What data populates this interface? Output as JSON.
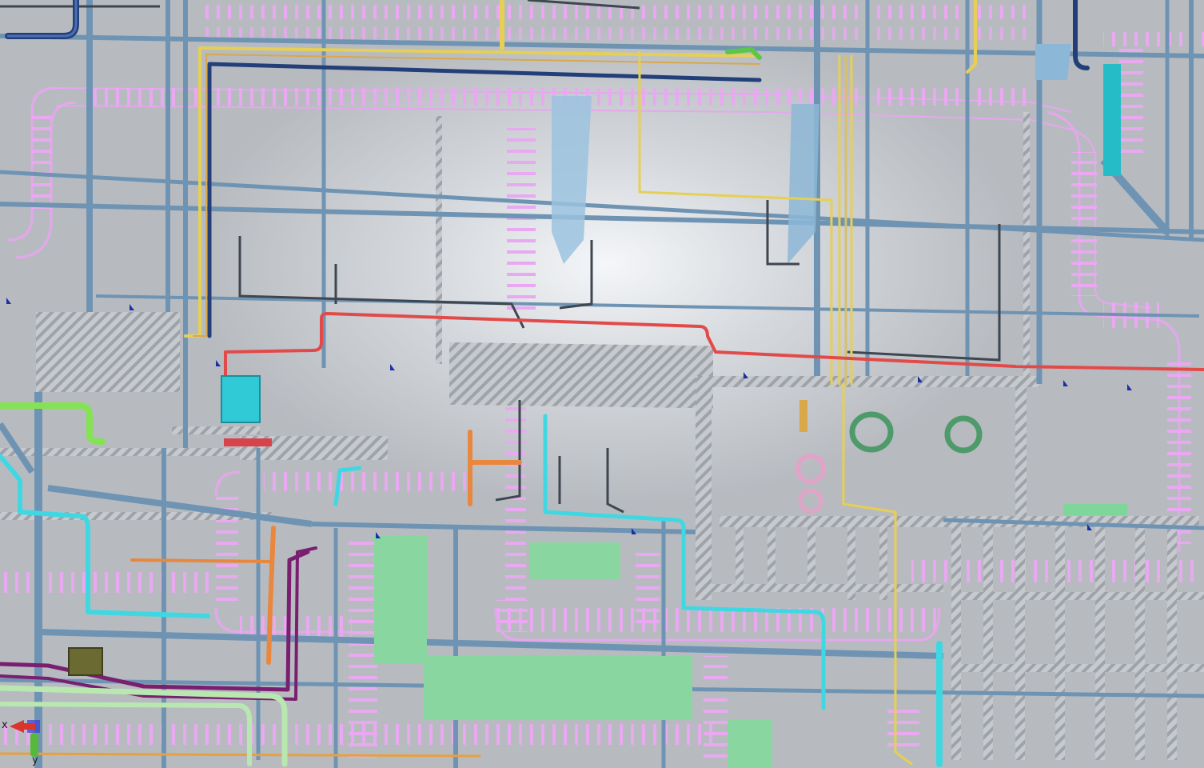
{
  "axis_triad": {
    "x_label": "x",
    "y_label": "y"
  },
  "colors": {
    "background": "#b9bcc1",
    "structural_beam": "#6f94b3",
    "cable_tray": "#e6a6ee",
    "hatched_slab": "#9aa0a6",
    "pipe_red": "#e24a4a",
    "pipe_yellow": "#e6cf55",
    "pipe_orange": "#e9873e",
    "pipe_cyan": "#3fd8e2",
    "pipe_navy": "#233f7a",
    "pipe_green": "#86e255",
    "pipe_purple": "#7a1f70",
    "equipment_green": "#8ad6a0",
    "equipment_cyan": "#30c9d6",
    "axis_x": "#d9352c",
    "axis_y": "#56b83c",
    "axis_z": "#3a3ad0"
  }
}
